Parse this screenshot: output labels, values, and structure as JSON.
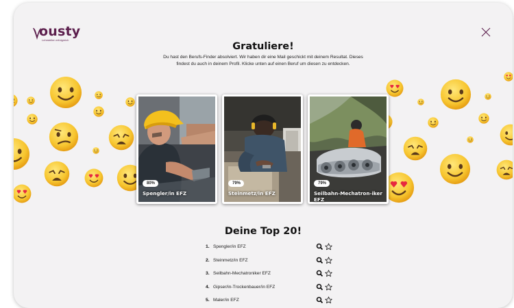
{
  "brand": {
    "name": "ousty",
    "tagline": "Lehrstellen erfolgreich"
  },
  "header": {
    "title": "Gratuliere!"
  },
  "intro": {
    "line1": "Du hast den Berufs-Finder absolviert. Wir haben dir eine Mail geschickt mit deinem Resultat. Dieses",
    "line2": "findest du auch in deinem Profil. Klicke unten auf einen Beruf um diesen zu entdecken."
  },
  "cards": [
    {
      "percent": "80%",
      "name": "Spengler/in EFZ"
    },
    {
      "percent": "79%",
      "name": "Steinmetz/in EFZ"
    },
    {
      "percent": "79%",
      "name": "Seilbahn-Mechatron-iker EFZ"
    }
  ],
  "top": {
    "title": "Deine Top 20!",
    "items": [
      {
        "rank": "1.",
        "name": "Spengler/in EFZ"
      },
      {
        "rank": "2.",
        "name": "Steinmetz/in EFZ"
      },
      {
        "rank": "3.",
        "name": "Seilbahn-Mechatroniker EFZ"
      },
      {
        "rank": "4.",
        "name": "Gipser/in-Trockenbauer/in EFZ"
      },
      {
        "rank": "5.",
        "name": "Maler/in EFZ"
      }
    ]
  },
  "icons": {
    "close": "close-icon",
    "search": "search-icon",
    "star": "star-outline-icon"
  },
  "colors": {
    "brand": "#5c1f4d",
    "modal_bg": "#f3f2f3",
    "emoji_yellow": "#f8c630"
  }
}
